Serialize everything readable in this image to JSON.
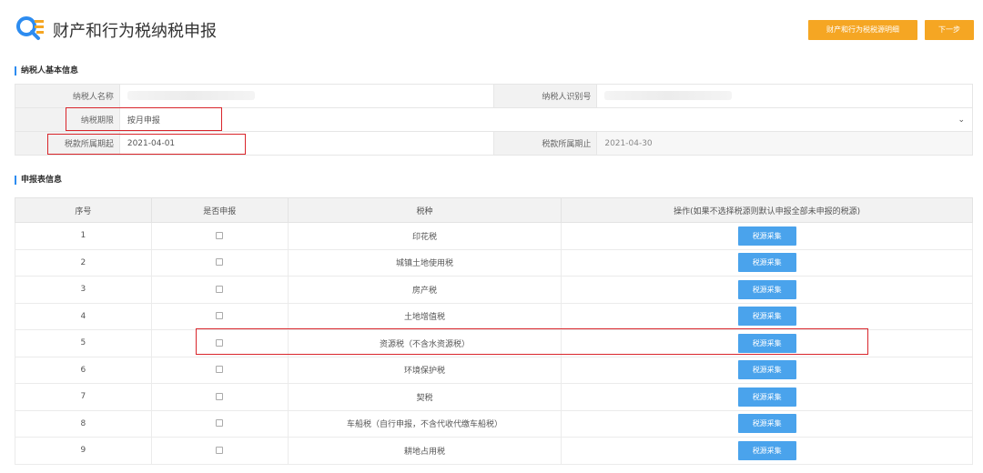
{
  "header": {
    "title": "财产和行为税纳税申报",
    "detail_button": "财产和行为税税源明细",
    "next_button": "下一步"
  },
  "basic_info": {
    "heading": "纳税人基本信息",
    "taxpayer_name_label": "纳税人名称",
    "taxpayer_name_value": "",
    "taxpayer_id_label": "纳税人识别号",
    "taxpayer_id_value": "",
    "period_label": "纳税期限",
    "period_value": "按月申报",
    "start_label": "税款所属期起",
    "start_value": "2021-04-01",
    "end_label": "税款所属期止",
    "end_value": "2021-04-30"
  },
  "declaration": {
    "heading": "申报表信息",
    "columns": [
      "序号",
      "是否申报",
      "税种",
      "操作(如果不选择税源则默认申报全部未申报的税源)"
    ],
    "action_label": "税源采集",
    "rows": [
      {
        "no": "1",
        "tax": "印花税",
        "checked": false
      },
      {
        "no": "2",
        "tax": "城镇土地使用税",
        "checked": false
      },
      {
        "no": "3",
        "tax": "房产税",
        "checked": false
      },
      {
        "no": "4",
        "tax": "土地增值税",
        "checked": false
      },
      {
        "no": "5",
        "tax": "资源税（不含水资源税）",
        "checked": false
      },
      {
        "no": "6",
        "tax": "环境保护税",
        "checked": false
      },
      {
        "no": "7",
        "tax": "契税",
        "checked": false
      },
      {
        "no": "8",
        "tax": "车船税（自行申报，不含代收代缴车船税）",
        "checked": false
      },
      {
        "no": "9",
        "tax": "耕地占用税",
        "checked": false
      }
    ]
  },
  "colors": {
    "accent_orange": "#f5a623",
    "button_blue": "#4aa3ec",
    "highlight_red": "#d9252b",
    "heading_bar": "#2d8cf0"
  }
}
